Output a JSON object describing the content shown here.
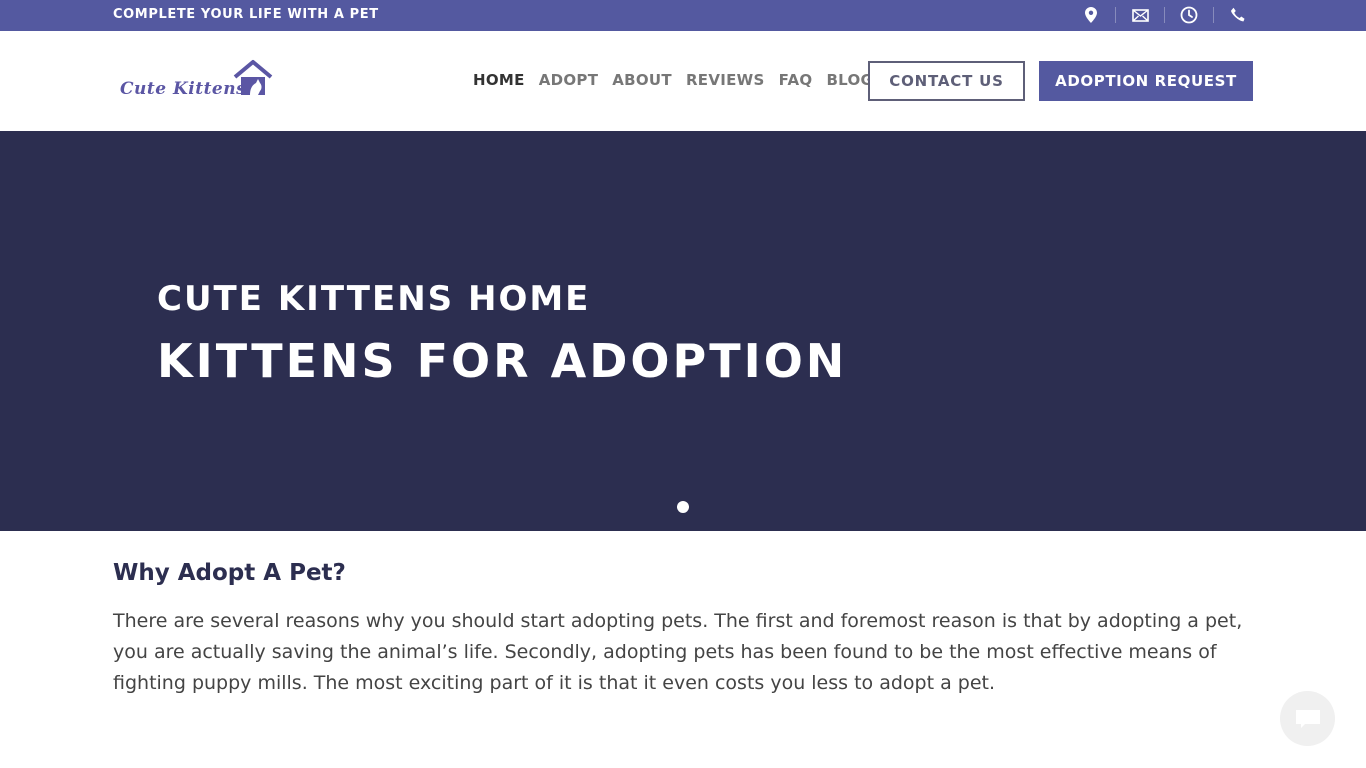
{
  "topbar": {
    "tagline": "COMPLETE YOUR LIFE WITH A PET",
    "icons": [
      "map-pin-icon",
      "envelope-icon",
      "clock-icon",
      "phone-icon"
    ]
  },
  "header": {
    "logo_text": "Cute Kittens",
    "nav": [
      {
        "label": "HOME",
        "active": true
      },
      {
        "label": "ADOPT",
        "active": false
      },
      {
        "label": "ABOUT",
        "active": false
      },
      {
        "label": "REVIEWS",
        "active": false
      },
      {
        "label": "FAQ",
        "active": false
      },
      {
        "label": "BLOG",
        "active": false
      }
    ],
    "contact_button": "CONTACT US",
    "adoption_button": "ADOPTION REQUEST"
  },
  "hero": {
    "subtitle": "CUTE KITTENS HOME",
    "title": "KITTENS FOR ADOPTION",
    "slides": 1,
    "active_slide": 1
  },
  "content": {
    "heading": "Why Adopt A Pet?",
    "paragraph": "There are several reasons why you should start adopting pets. The first and foremost reason is that by adopting a pet, you are actually saving the animal’s life. Secondly, adopting pets has been found to be the most effective means of fighting puppy mills. The most exciting part of it is that it even costs you less to adopt a pet."
  },
  "colors": {
    "brand": "#5459a0",
    "hero_bg": "#2c2e50",
    "heading": "#2c2e50"
  }
}
